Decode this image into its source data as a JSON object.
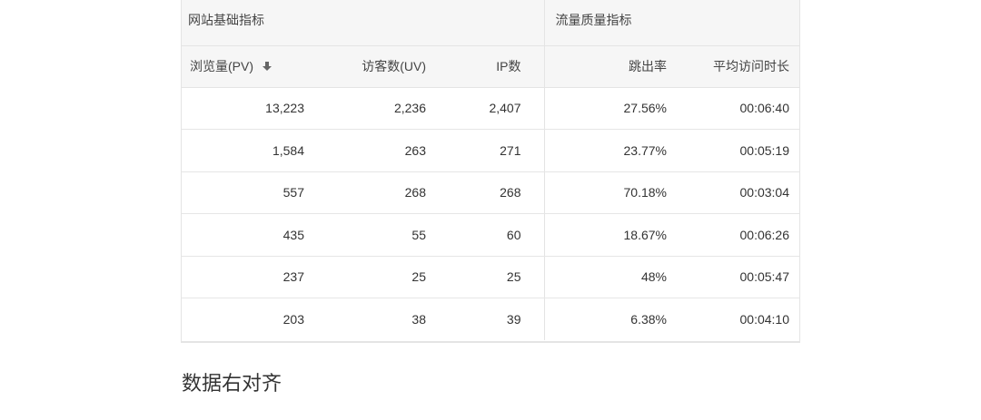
{
  "table": {
    "group_headers": {
      "basic": "网站基础指标",
      "quality": "流量质量指标"
    },
    "columns": [
      {
        "label": "浏览量(PV)",
        "sort_icon": "arrow-down-icon"
      },
      {
        "label": "访客数(UV)"
      },
      {
        "label": "IP数"
      },
      {
        "label": "跳出率"
      },
      {
        "label": "平均访问时长"
      }
    ],
    "rows": [
      {
        "pv": "13,223",
        "uv": "2,236",
        "ip": "2,407",
        "bounce": "27.56%",
        "avg_time": "00:06:40"
      },
      {
        "pv": "1,584",
        "uv": "263",
        "ip": "271",
        "bounce": "23.77%",
        "avg_time": "00:05:19"
      },
      {
        "pv": "557",
        "uv": "268",
        "ip": "268",
        "bounce": "70.18%",
        "avg_time": "00:03:04"
      },
      {
        "pv": "435",
        "uv": "55",
        "ip": "60",
        "bounce": "18.67%",
        "avg_time": "00:06:26"
      },
      {
        "pv": "237",
        "uv": "25",
        "ip": "25",
        "bounce": "48%",
        "avg_time": "00:05:47"
      },
      {
        "pv": "203",
        "uv": "38",
        "ip": "39",
        "bounce": "6.38%",
        "avg_time": "00:04:10"
      }
    ]
  },
  "caption": "数据右对齐",
  "colors": {
    "header_bg": "#f6f6f6",
    "border": "#e4e4e4",
    "text": "#333333"
  }
}
